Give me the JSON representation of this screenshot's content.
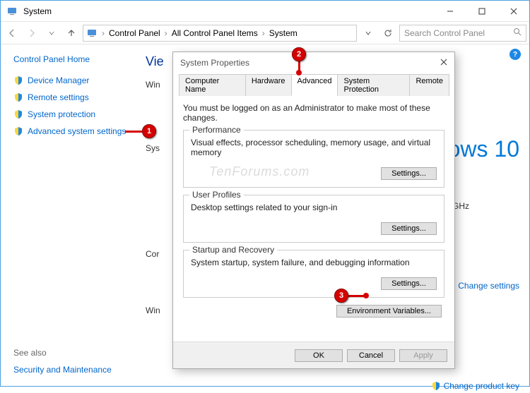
{
  "window": {
    "title": "System"
  },
  "breadcrumb": {
    "items": [
      "Control Panel",
      "All Control Panel Items",
      "System"
    ]
  },
  "search": {
    "placeholder": "Search Control Panel"
  },
  "sidebar": {
    "home": "Control Panel Home",
    "items": [
      {
        "label": "Device Manager"
      },
      {
        "label": "Remote settings"
      },
      {
        "label": "System protection"
      },
      {
        "label": "Advanced system settings"
      }
    ],
    "see_also": "See also",
    "see_also_item": "Security and Maintenance"
  },
  "main": {
    "peek_vie": "Vie",
    "peek_win": "Win",
    "peek_sys": "Sys",
    "peek_cor": "Cor",
    "peek_win2": "Win",
    "os_brand": "ndows 10",
    "ghz": "GHz",
    "change_settings": "Change settings",
    "change_key": "Change product key"
  },
  "dialog": {
    "title": "System Properties",
    "tabs": [
      "Computer Name",
      "Hardware",
      "Advanced",
      "System Protection",
      "Remote"
    ],
    "active_tab": 2,
    "notice": "You must be logged on as an Administrator to make most of these changes.",
    "groups": [
      {
        "title": "Performance",
        "desc": "Visual effects, processor scheduling, memory usage, and virtual memory",
        "btn": "Settings..."
      },
      {
        "title": "User Profiles",
        "desc": "Desktop settings related to your sign-in",
        "btn": "Settings..."
      },
      {
        "title": "Startup and Recovery",
        "desc": "System startup, system failure, and debugging information",
        "btn": "Settings..."
      }
    ],
    "env_btn": "Environment Variables...",
    "ok": "OK",
    "cancel": "Cancel",
    "apply": "Apply"
  },
  "badges": {
    "b1": "1",
    "b2": "2",
    "b3": "3"
  },
  "watermark": "TenForums.com"
}
